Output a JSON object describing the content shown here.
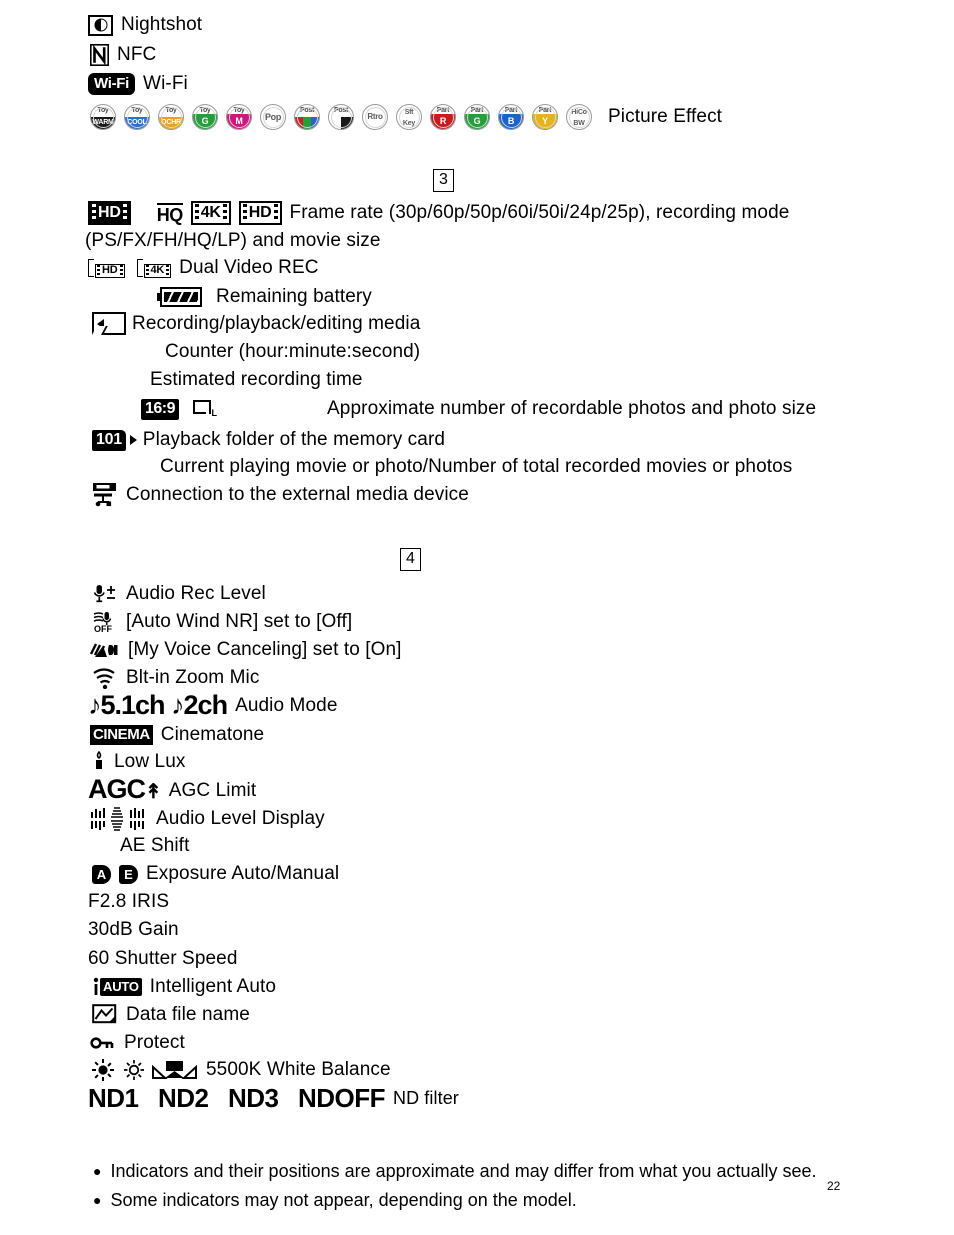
{
  "document": {
    "page_number": "22"
  },
  "section2_tail": {
    "items": [
      {
        "icon": "nightshot-icon",
        "label": "Nightshot"
      },
      {
        "icon": "nfc-icon",
        "label": "NFC"
      },
      {
        "icon": "wifi-icon",
        "icon_text": "Wi-Fi",
        "label": "Wi-Fi"
      }
    ],
    "picture_effect": {
      "label": "Picture Effect",
      "chips": [
        {
          "name": "toy-camera-warm",
          "top": "Toy",
          "bottom": "WARM",
          "color": "#1a1a1a"
        },
        {
          "name": "toy-camera-cool",
          "top": "Toy",
          "bottom": "COOL",
          "color": "#2a72c8"
        },
        {
          "name": "toy-camera-ochre",
          "top": "Toy",
          "bottom": "OCHR",
          "color": "#e8a317"
        },
        {
          "name": "toy-camera-green",
          "top": "Toy",
          "bottom": "G",
          "color": "#22a13a"
        },
        {
          "name": "toy-camera-magenta",
          "top": "Toy",
          "bottom": "M",
          "color": "#d4147e"
        },
        {
          "name": "pop-color",
          "top": "Pop",
          "bottom": "",
          "color": "#ffffff"
        },
        {
          "name": "posterization-color",
          "top": "Post",
          "bottom": "",
          "color": "#cc2222"
        },
        {
          "name": "posterization-bw",
          "top": "Post",
          "bottom": "",
          "color": "#222222"
        },
        {
          "name": "retro-photo",
          "top": "Rtro",
          "bottom": "",
          "color": "#ffffff"
        },
        {
          "name": "soft-high-key",
          "top": "Sft",
          "bottom": "Key",
          "color": "#ffffff"
        },
        {
          "name": "partial-color-red",
          "top": "Part",
          "bottom": "R",
          "color": "#cc1a1a"
        },
        {
          "name": "partial-color-green",
          "top": "Part",
          "bottom": "G",
          "color": "#22a13a"
        },
        {
          "name": "partial-color-blue",
          "top": "Part",
          "bottom": "B",
          "color": "#1a63c8"
        },
        {
          "name": "partial-color-yellow",
          "top": "Part",
          "bottom": "Y",
          "color": "#e8b317"
        },
        {
          "name": "high-contrast-mono",
          "top": "HiCo",
          "bottom": "BW",
          "color": "#ffffff"
        }
      ]
    }
  },
  "section3": {
    "number": "3",
    "frame_rate": {
      "icons": [
        {
          "name": "hd-inverted-icon",
          "text": "HD",
          "style": "inverted-film"
        },
        {
          "name": "hq-icon",
          "text": "HQ",
          "style": "underlined-text"
        },
        {
          "name": "4k-film-icon",
          "text": "4K",
          "style": "film"
        },
        {
          "name": "hd-film-icon",
          "text": "HD",
          "style": "film"
        }
      ],
      "line1": "Frame rate (30p/60p/50p/60i/50i/24p/25p), recording mode",
      "line2": "(PS/FX/FH/HQ/LP) and movie size"
    },
    "dual_video_rec": {
      "icons": [
        {
          "name": "dual-rec-hd-icon",
          "text": "HD"
        },
        {
          "name": "dual-rec-4k-icon",
          "text": "4K"
        }
      ],
      "label": "Dual Video REC"
    },
    "battery": {
      "icon": "battery-icon",
      "label": "Remaining battery"
    },
    "media": {
      "icon": "recording-media-icon",
      "label": "Recording/playback/editing media"
    },
    "counter": {
      "label": "Counter (hour:minute:second)"
    },
    "estimated_time": {
      "label": "Estimated recording time"
    },
    "photo_info": {
      "aspect_badge": "16:9",
      "photo_size_icon": "photo-size-icon",
      "photo_size_letter": "L",
      "label": "Approximate number of recordable photos and photo size"
    },
    "playback_folder": {
      "badge": "101",
      "label": "Playback folder of the memory card"
    },
    "current_playing": {
      "label": "Current playing movie or photo/Number of total recorded movies or photos"
    },
    "external_media": {
      "icon": "external-media-device-icon",
      "label": "Connection to the external media device"
    }
  },
  "section4": {
    "number": "4",
    "items": [
      {
        "icon": "mic-plus-icon",
        "label": "Audio Rec Level"
      },
      {
        "icon": "auto-wind-nr-off-icon",
        "label": "[Auto Wind NR] set to [Off]"
      },
      {
        "icon": "my-voice-canceling-icon",
        "label": "[My Voice Canceling] set to [On]"
      },
      {
        "icon": "built-in-zoom-mic-icon",
        "label": "Blt-in Zoom Mic"
      },
      {
        "icon": "audio-mode-icon",
        "icon_text": "♪5.1ch ♪2ch",
        "label": "Audio Mode"
      },
      {
        "icon": "cinematone-icon",
        "icon_text": "CINEMA",
        "label": "Cinematone"
      },
      {
        "icon": "low-lux-icon",
        "label": "Low Lux"
      },
      {
        "icon": "agc-limit-icon",
        "icon_text": "AGC",
        "label": "AGC Limit"
      },
      {
        "icon": "audio-level-display-icon",
        "label": "Audio Level Display"
      },
      {
        "icon": "",
        "label": "AE Shift"
      },
      {
        "icon": "exposure-auto-manual-icon",
        "label": "Exposure Auto/Manual",
        "badges": [
          "A",
          "E"
        ]
      },
      {
        "icon": "",
        "label": "F2.8 IRIS"
      },
      {
        "icon": "",
        "label": "30dB Gain"
      },
      {
        "icon": "",
        "label": "60 Shutter Speed"
      },
      {
        "icon": "intelligent-auto-icon",
        "icon_text": "AUTO",
        "label": "Intelligent Auto"
      },
      {
        "icon": "data-file-name-icon",
        "label": "Data file name"
      },
      {
        "icon": "protect-icon",
        "label": "Protect"
      },
      {
        "icon": "white-balance-icon",
        "label": "5500K White Balance"
      },
      {
        "icon": "nd-filter-icon",
        "label": "ND filter"
      }
    ],
    "nd_filter": {
      "values": [
        "ND1",
        "ND2",
        "ND3",
        "NDOFF"
      ],
      "label": "ND filter"
    }
  },
  "notes": [
    "Indicators and their positions are approximate and may differ from what you actually see.",
    "Some indicators may not appear, depending on the model."
  ]
}
